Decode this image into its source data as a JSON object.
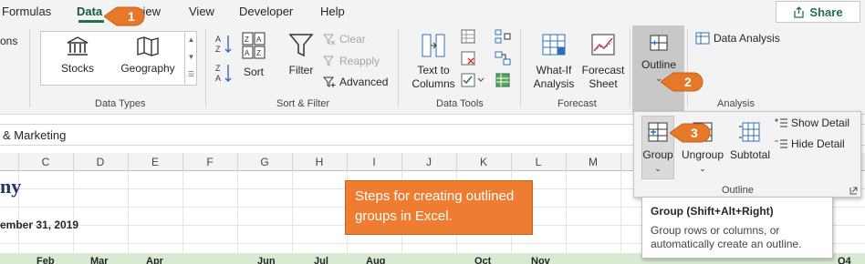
{
  "tabs": [
    {
      "label": "Formulas"
    },
    {
      "label": "Data"
    },
    {
      "label": "view"
    },
    {
      "label": "View"
    },
    {
      "label": "Developer"
    },
    {
      "label": "Help"
    }
  ],
  "share_label": "Share",
  "ribbon": {
    "cut_off_label": "ons",
    "data_types": {
      "stocks": "Stocks",
      "geography": "Geography",
      "group_label": "Data Types"
    },
    "sort_filter": {
      "sort": "Sort",
      "filter": "Filter",
      "clear": "Clear",
      "reapply": "Reapply",
      "advanced": "Advanced",
      "group_label": "Sort & Filter"
    },
    "data_tools": {
      "text_to": "Text to",
      "columns": "Columns",
      "group_label": "Data Tools"
    },
    "forecast": {
      "whatif_1": "What-If",
      "whatif_2": "Analysis",
      "sheet_1": "Forecast",
      "sheet_2": "Sheet",
      "group_label": "Forecast"
    },
    "outline": {
      "label": "Outline"
    },
    "analysis": {
      "data_analysis": "Data Analysis",
      "group_label": "Analysis"
    }
  },
  "outline_dropdown": {
    "group": "Group",
    "ungroup": "Ungroup",
    "subtotal": "Subtotal",
    "show_detail": "Show Detail",
    "hide_detail": "Hide Detail",
    "label": "Outline"
  },
  "tooltip": {
    "title": "Group (Shift+Alt+Right)",
    "body": "Group rows or columns, or automatically create an outline."
  },
  "formula_bar": {
    "text": "& Marketing"
  },
  "columns": [
    "C",
    "D",
    "E",
    "F",
    "G",
    "H",
    "I",
    "J",
    "K",
    "L",
    "M"
  ],
  "sheet": {
    "title": "ny",
    "date": "ember 31, 2019",
    "months": [
      "Feb",
      "Mar",
      "Apr",
      "Jun",
      "Jul",
      "Aug",
      "Oct",
      "Nov",
      "Q4"
    ]
  },
  "callouts": {
    "step1": "1",
    "step2": "2",
    "step3": "3",
    "steps_text": "Steps for creating outlined groups in Excel."
  },
  "colors": {
    "accent_green": "#217346",
    "callout_orange": "#ee7d31",
    "title_navy": "#1f3864",
    "month_row_fill": "#d9ead3"
  }
}
